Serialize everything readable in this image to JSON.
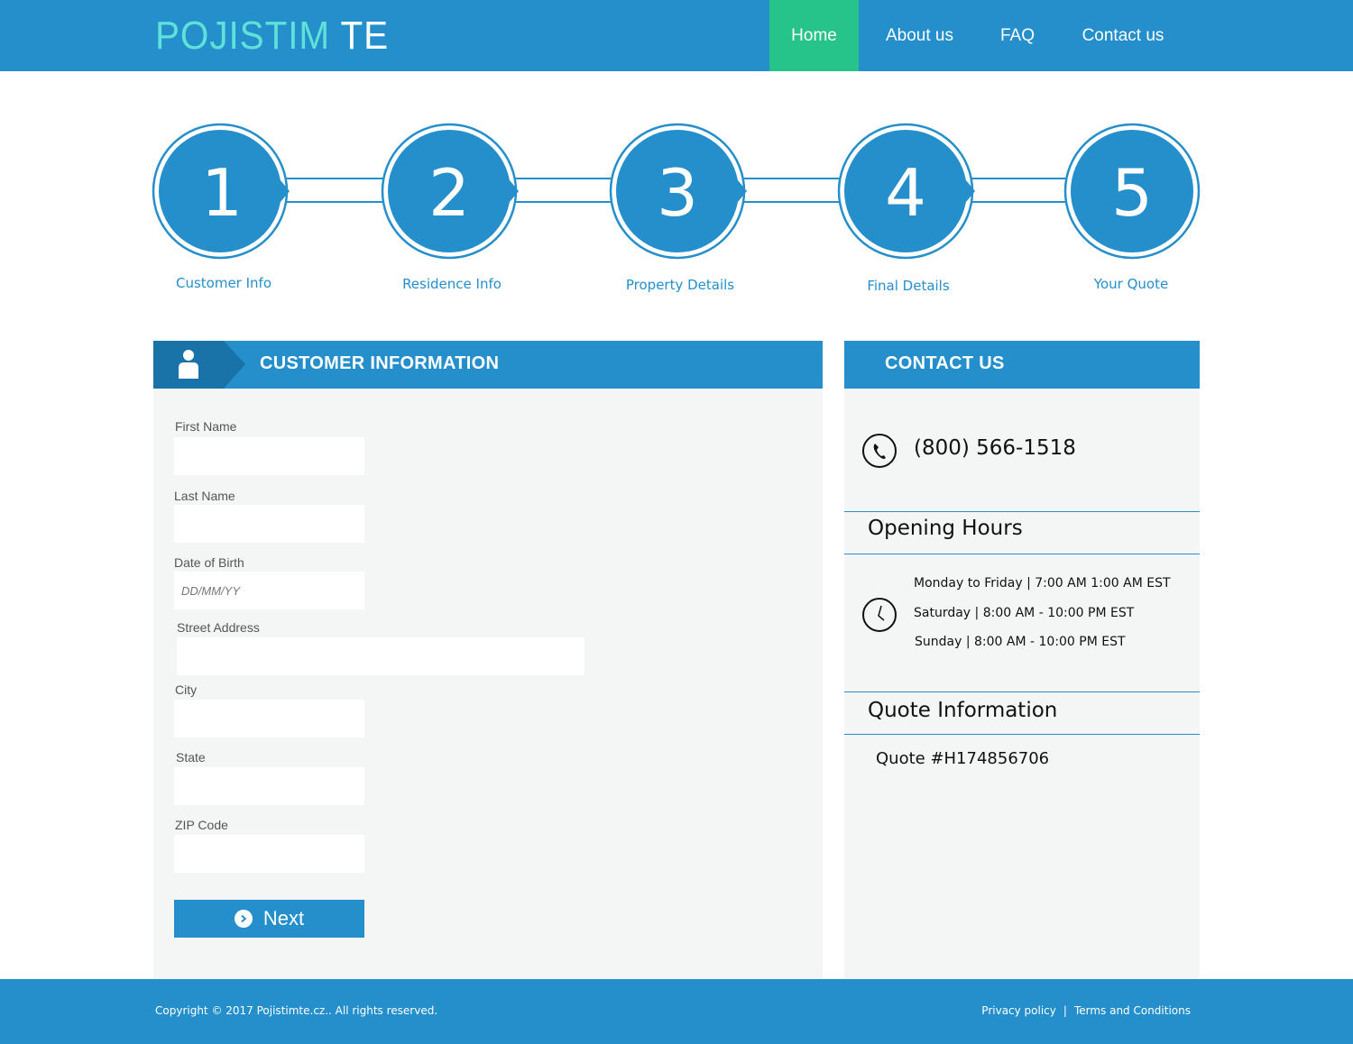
{
  "header": {
    "logo_part1": "POJISTIM",
    "logo_part2": "TE",
    "nav": [
      {
        "label": "Home",
        "active": true
      },
      {
        "label": "About us",
        "active": false
      },
      {
        "label": "FAQ",
        "active": false
      },
      {
        "label": "Contact us",
        "active": false
      }
    ]
  },
  "steps": [
    {
      "number": "1",
      "label": "Customer Info"
    },
    {
      "number": "2",
      "label": "Residence Info"
    },
    {
      "number": "3",
      "label": "Property Details"
    },
    {
      "number": "4",
      "label": "Final Details"
    },
    {
      "number": "5",
      "label": "Your Quote"
    }
  ],
  "form": {
    "title": "CUSTOMER INFORMATION",
    "icon": "person-icon",
    "fields": [
      {
        "label": "First Name",
        "value": "",
        "placeholder": ""
      },
      {
        "label": "Last Name",
        "value": "",
        "placeholder": ""
      },
      {
        "label": "Date of Birth",
        "value": "",
        "placeholder": "DD/MM/YY"
      },
      {
        "label": "Street Address",
        "value": "",
        "placeholder": ""
      },
      {
        "label": "City",
        "value": "",
        "placeholder": ""
      },
      {
        "label": "State",
        "value": "",
        "placeholder": ""
      },
      {
        "label": "ZIP Code",
        "value": "",
        "placeholder": ""
      }
    ],
    "next_label": "Next"
  },
  "contact": {
    "title": "CONTACT US",
    "phone": "(800) 566-1518",
    "hours_title": "Opening Hours",
    "hours": [
      "Monday to Friday | 7:00 AM 1:00 AM EST",
      "Saturday | 8:00 AM - 10:00 PM EST",
      "Sunday | 8:00 AM - 10:00 PM EST"
    ],
    "quote_title": "Quote Information",
    "quote_number": "Quote #H174856706"
  },
  "footer": {
    "copyright": "Copyright © 2017 Pojistimte.cz.. All rights reserved.",
    "privacy": "Privacy policy",
    "separator": "|",
    "terms": "Terms and Conditions"
  },
  "colors": {
    "primary": "#248fcb",
    "active_nav": "#26c38a",
    "panel_bg": "#f4f5f5"
  }
}
